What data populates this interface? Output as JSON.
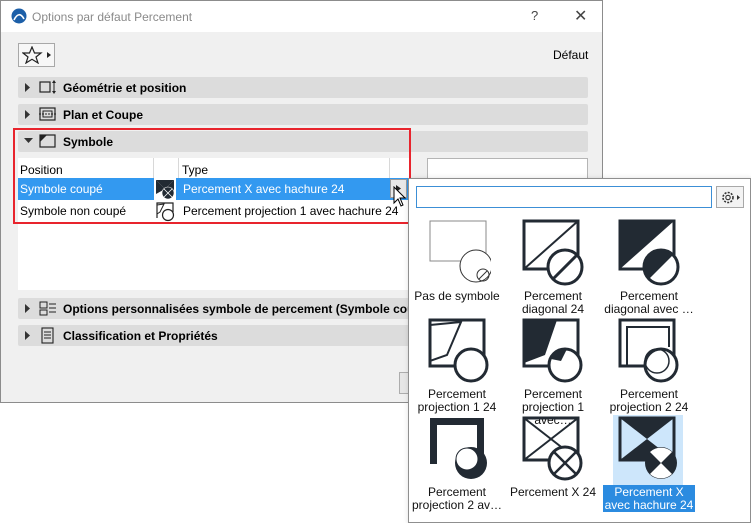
{
  "window": {
    "title": "Options par défaut Percement",
    "help": "?",
    "close": "✕"
  },
  "toolbar": {
    "default_label": "Défaut"
  },
  "panels": {
    "geometry": "Géométrie et position",
    "plan": "Plan et Coupe",
    "symbol": "Symbole",
    "custom": "Options personnalisées symbole de percement (Symbole coupé)",
    "classification": "Classification et Propriétés"
  },
  "symbol_table": {
    "headers": [
      "Position",
      "Type"
    ],
    "rows": [
      {
        "position": "Symbole coupé",
        "type": "Percement X avec hachure 24",
        "selected": true
      },
      {
        "position": "Symbole non coupé",
        "type": "Percement projection 1 avec hachure 24",
        "selected": false
      }
    ]
  },
  "popup": {
    "search_value": "",
    "tiles": [
      {
        "label": "Pas de symbole",
        "icon": "no-symbol-icon"
      },
      {
        "label": "Percement diagonal 24",
        "icon": "diagonal-icon"
      },
      {
        "label": "Percement diagonal avec …",
        "icon": "diagonal-filled-icon"
      },
      {
        "label": "Percement projection 1 24",
        "icon": "projection1-icon"
      },
      {
        "label": "Percement projection 1 avec…",
        "icon": "projection1-filled-icon"
      },
      {
        "label": "Percement projection 2 24",
        "icon": "projection2-icon"
      },
      {
        "label": "Percement projection 2 av…",
        "icon": "projection2-filled-icon"
      },
      {
        "label": "Percement X 24",
        "icon": "x-icon"
      },
      {
        "label": "Percement X avec hachure 24",
        "icon": "x-filled-icon",
        "selected": true
      }
    ]
  },
  "colors": {
    "selection": "#3399f0",
    "highlight_box": "#e8242d",
    "tile_selected": "#cde6fb",
    "symbol_dark": "#222a33"
  }
}
